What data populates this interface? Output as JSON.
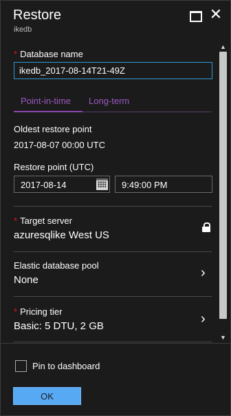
{
  "header": {
    "title": "Restore",
    "subtitle": "ikedb",
    "maximize_icon": "maximize-icon",
    "close_icon": "close-icon",
    "close_glyph": "✕"
  },
  "database_name": {
    "required_mark": "*",
    "label": "Database name",
    "value": "ikedb_2017-08-14T21-49Z"
  },
  "tabs": {
    "point_in_time": "Point-in-time",
    "long_term": "Long-term",
    "active": "Point-in-time",
    "accent_color": "#8e44ad"
  },
  "oldest_restore_point": {
    "label": "Oldest restore point",
    "value": "2017-08-07 00:00 UTC"
  },
  "restore_point": {
    "label": "Restore point (UTC)",
    "date": "2017-08-14",
    "time": "9:49:00 PM",
    "calendar_icon": "calendar-icon"
  },
  "target_server": {
    "required_mark": "*",
    "label": "Target server",
    "value": "azuresqlike West US",
    "icon": "lock-icon"
  },
  "elastic_pool": {
    "label": "Elastic database pool",
    "value": "None",
    "chevron": "›"
  },
  "pricing_tier": {
    "required_mark": "*",
    "label": "Pricing tier",
    "value": "Basic: 5 DTU, 2 GB",
    "chevron": "›"
  },
  "scrollbar": {
    "up_glyph": "▲",
    "down_glyph": "▼"
  },
  "footer": {
    "pin_label": "Pin to dashboard",
    "pin_checked": false,
    "ok_label": "OK",
    "ok_color": "#57a9f4"
  }
}
